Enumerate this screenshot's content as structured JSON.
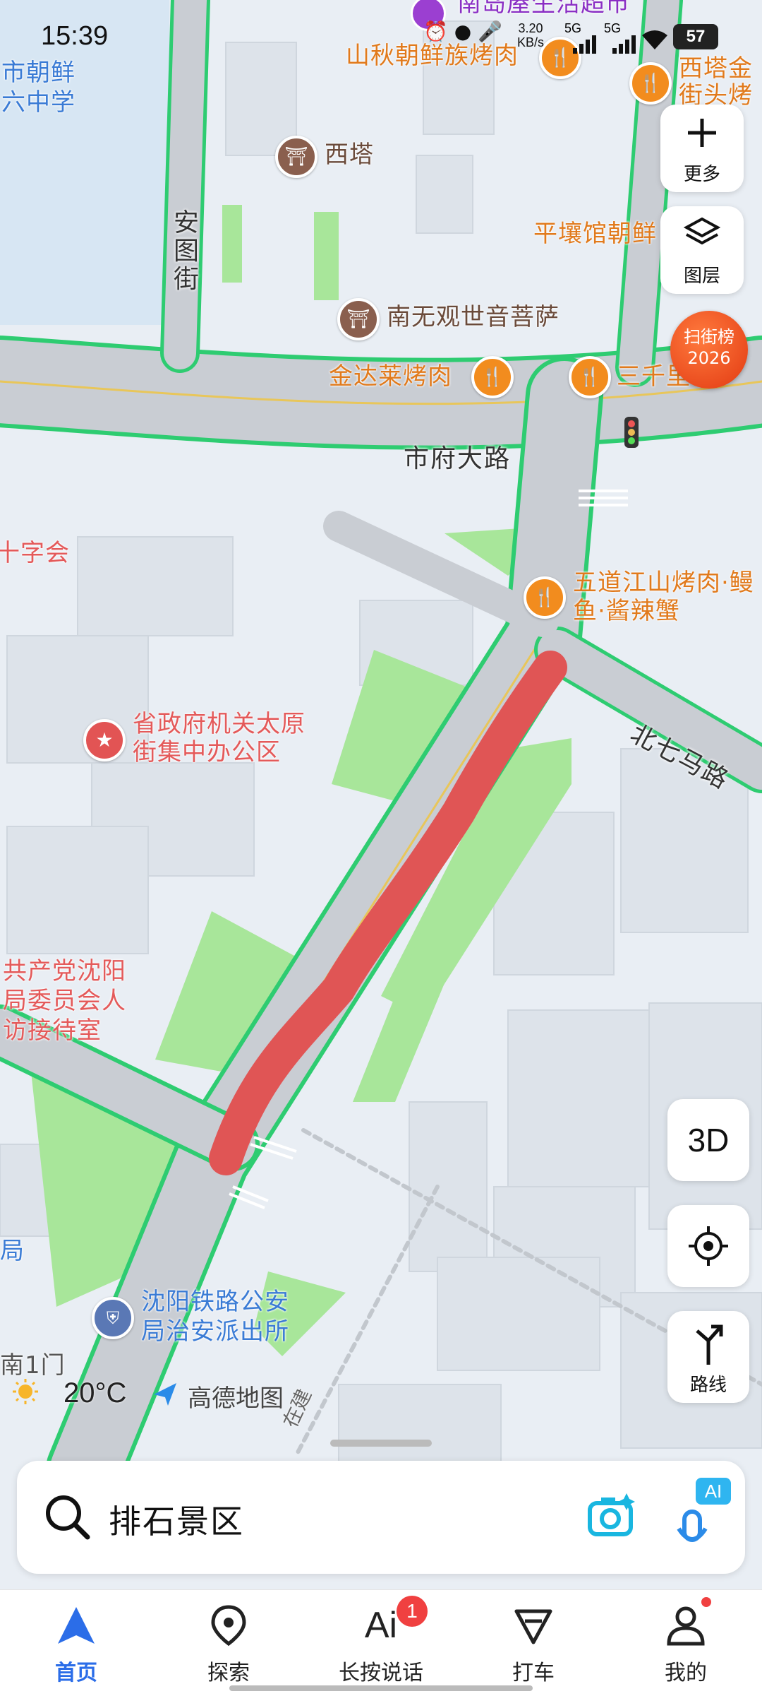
{
  "status_bar": {
    "time": "15:39",
    "net_speed_value": "3.20",
    "net_speed_unit": "KB/s",
    "signal1": "5G",
    "signal2": "5G",
    "battery": "57"
  },
  "map": {
    "street_labels": {
      "shifu": "市府大路",
      "beiqima": "北七马路",
      "antu": "安图街",
      "zaijian": "在建"
    },
    "pois": {
      "nandao": "南岛屋生活超市",
      "shanqiu": "山秋朝鲜族烤肉",
      "xita_jin": "西塔金",
      "xita_jin2": "街头烤",
      "xita": "西塔",
      "pingrang": "平壤馆朝鲜",
      "nanwu": "南无观世音菩萨",
      "jindalai": "金达莱烤肉",
      "sanqian": "三千里",
      "shizhaoxian1": "市朝鲜",
      "shizhaoxian2": "六中学",
      "hongshizi": "十字会",
      "wudao1": "五道江山烤肉·鳗",
      "wudao2": "鱼·酱辣蟹",
      "shengzhengfu1": "省政府机关太原",
      "shengzhengfu2": "街集中办公区",
      "gongchandang1": "共产党沈阳",
      "gongchandang2": "局委员会人",
      "gongchandang3": "访接待室",
      "tielu1": "沈阳铁路公安",
      "tielu2": "局治安派出所",
      "ju": "局",
      "nanmen": "南1门"
    },
    "weather": {
      "temp": "20°C",
      "icon": "sun-icon"
    },
    "brand": "高德地图",
    "scan_badge": {
      "line1": "扫街榜",
      "line2": "2026"
    },
    "route_color": "#e05555"
  },
  "controls": {
    "more": "更多",
    "layers": "图层",
    "three_d": "3D",
    "route": "路线"
  },
  "search": {
    "value": "排石景区",
    "ai_badge": "AI"
  },
  "nav": {
    "items": [
      {
        "label": "首页",
        "icon": "navigation-arrow-icon",
        "active": true
      },
      {
        "label": "探索",
        "icon": "location-pin-icon",
        "active": false
      },
      {
        "label": "长按说话",
        "icon": "ai-voice-icon",
        "active": false,
        "badge": "1"
      },
      {
        "label": "打车",
        "icon": "taxi-icon",
        "active": false
      },
      {
        "label": "我的",
        "icon": "profile-icon",
        "active": false
      }
    ]
  },
  "colors": {
    "accent": "#2b6de8",
    "road_edge": "#2ecc71",
    "road": "#c9cdd3",
    "park": "#a8e69a",
    "route": "#e05555"
  }
}
